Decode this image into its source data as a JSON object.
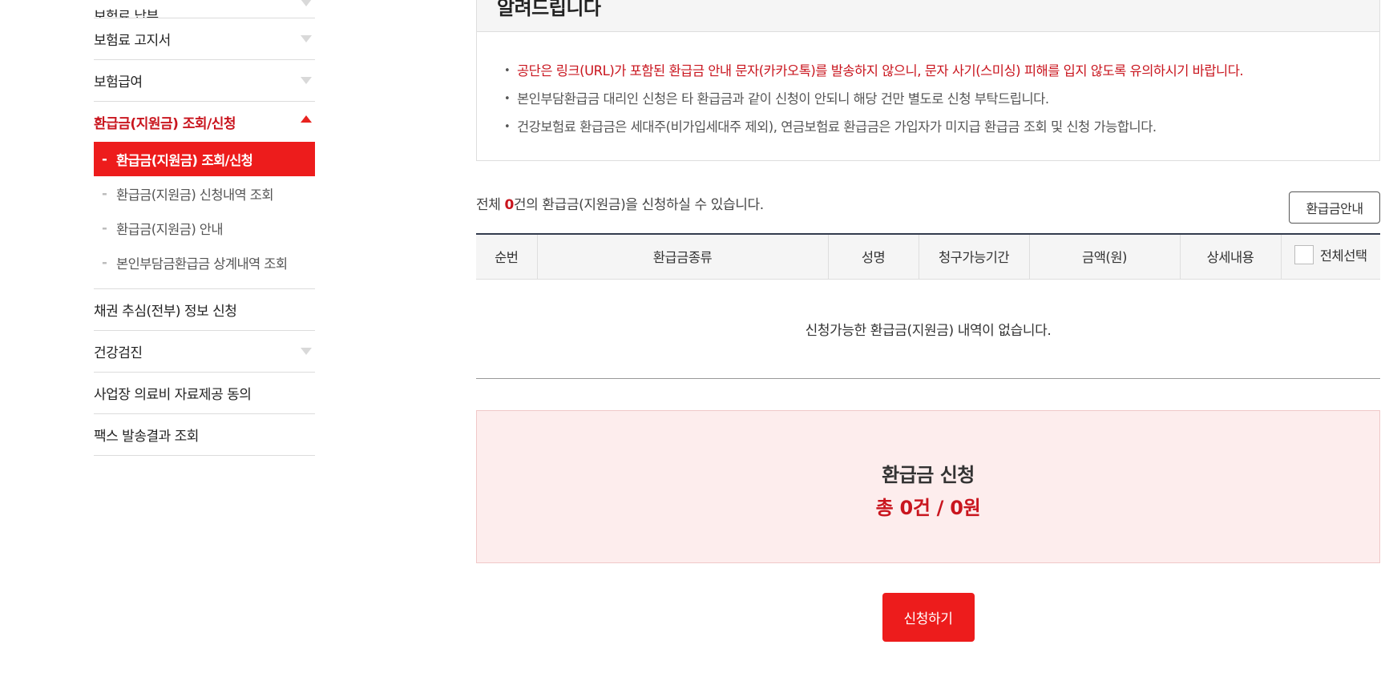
{
  "sidebar": {
    "items_top": [
      {
        "label": "보험료 납부",
        "has_arrow": true,
        "partial": true
      },
      {
        "label": "보험료 고지서",
        "has_arrow": true
      },
      {
        "label": "보험급여",
        "has_arrow": true
      }
    ],
    "active_parent": {
      "label": "환급금(지원금) 조회/신청"
    },
    "submenu": [
      {
        "label": "환급금(지원금) 조회/신청",
        "current": true
      },
      {
        "label": "환급금(지원금) 신청내역 조회"
      },
      {
        "label": "환급금(지원금) 안내"
      },
      {
        "label": "본인부담금환급금 상계내역 조회"
      }
    ],
    "items_bottom": [
      {
        "label": "채권 추심(전부) 정보 신청",
        "has_arrow": false
      },
      {
        "label": "건강검진",
        "has_arrow": true
      },
      {
        "label": "사업장 의료비 자료제공 동의",
        "has_arrow": false
      },
      {
        "label": "팩스 발송결과 조회",
        "has_arrow": false
      }
    ],
    "dash": "-"
  },
  "notice": {
    "title": "알려드립니다",
    "lines": [
      {
        "text": "공단은 링크(URL)가 포함된 환급금 안내 문자(카카오톡)를 발송하지 않으니, 문자 사기(스미싱) 피해를 입지 않도록 유의하시기 바랍니다.",
        "highlight": true
      },
      {
        "text": "본인부담환급금 대리인 신청은 타 환급금과 같이 신청이 안되니 해당 건만 별도로 신청 부탁드립니다.",
        "highlight": false
      },
      {
        "text": "건강보험료 환급금은 세대주(비가입세대주 제외), 연금보험료 환급금은 가입자가 미지급 환급금 조회 및 신청 가능합니다.",
        "highlight": false
      }
    ]
  },
  "summary": {
    "prefix": "전체 ",
    "count": "0",
    "suffix": "건의 환급금(지원금)을 신청하실 수 있습니다.",
    "guide_button": "환급금안내"
  },
  "table": {
    "headers": [
      "순번",
      "환급금종류",
      "성명",
      "청구가능기간",
      "금액(원)",
      "상세내용"
    ],
    "select_all_label": "전체선택",
    "empty_message": "신청가능한 환급금(지원금) 내역이 없습니다."
  },
  "apply": {
    "title": "환급금 신청",
    "total": "총 0건 / 0원",
    "submit_button": "신청하기"
  },
  "colors": {
    "accent_red": "#ed1c1c",
    "text_red": "#c9151e",
    "apply_bg": "#fdeded"
  }
}
